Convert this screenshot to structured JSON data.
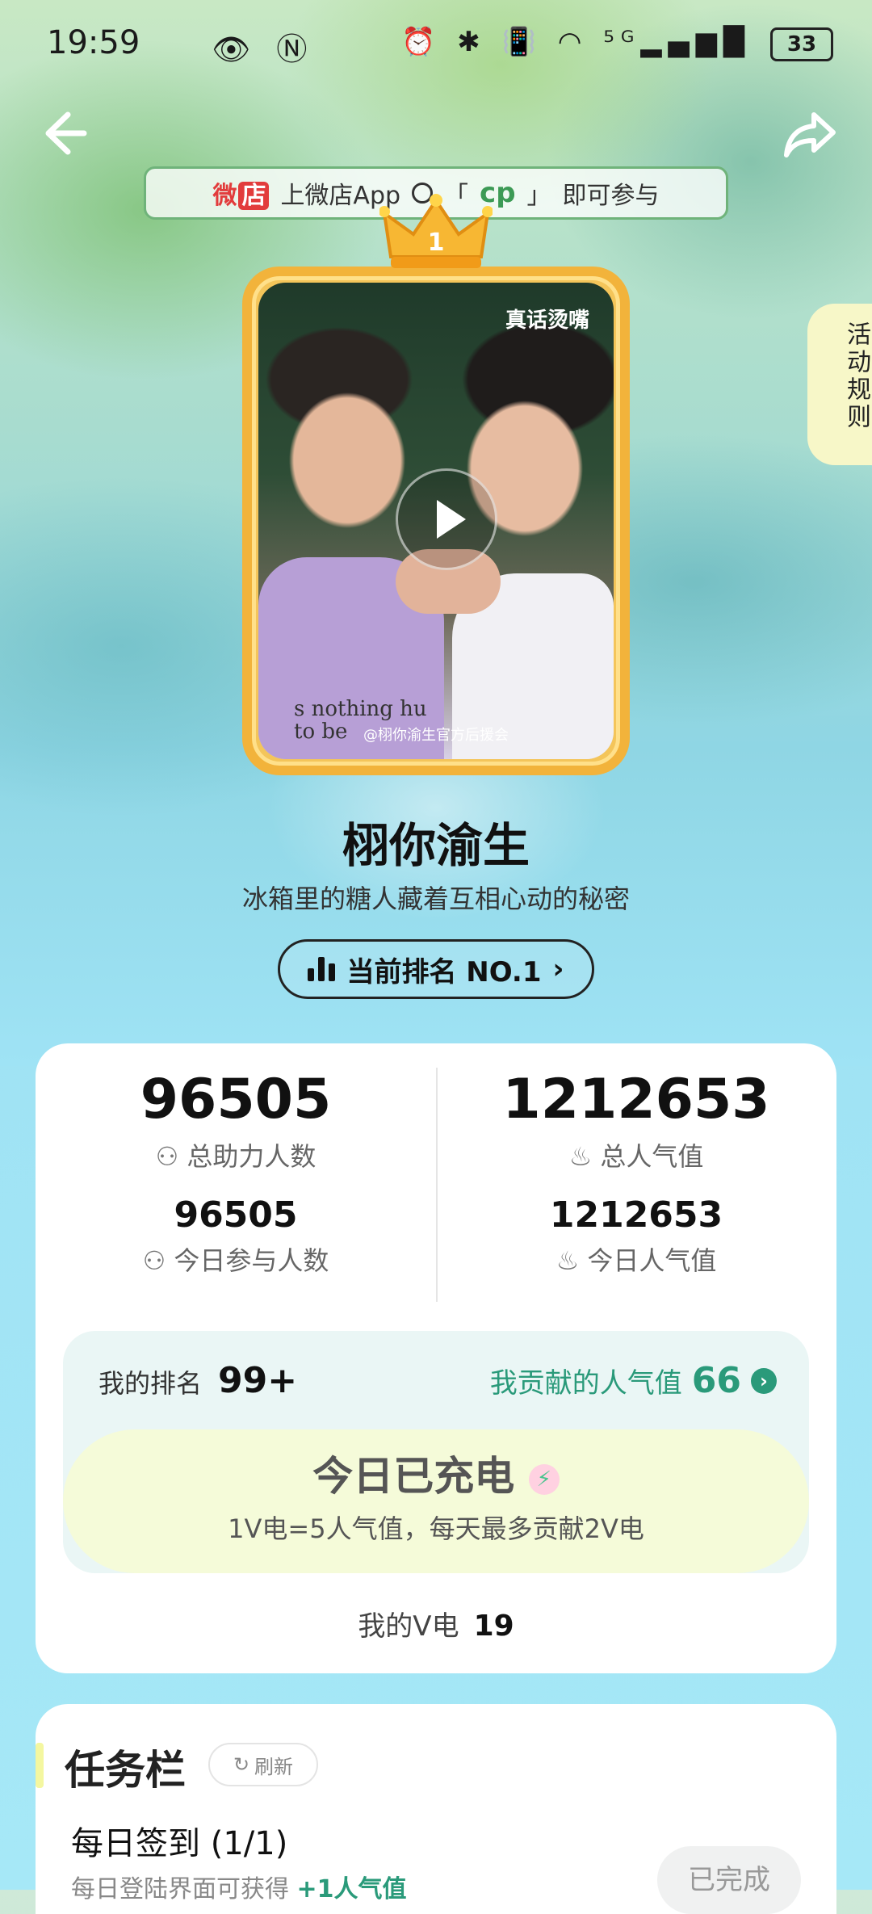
{
  "status_bar": {
    "time": "19:59",
    "left_icons": "👁 Ⓝ",
    "right_icons": "⏰ ✱ 📳 ◠ ⁵ᴳ▂▄▆█",
    "battery": "33"
  },
  "promo": {
    "weidian_prefix": "微",
    "weidian_badge": "店",
    "text_before": "上微店App",
    "bracket_open": "「",
    "keyword": "cp",
    "bracket_close": "」",
    "text_after": "即可参与"
  },
  "crown_number": "1",
  "video": {
    "caption": "真话烫嘴",
    "credit": "@栩你渝生官方后援会",
    "shirt_text": "s nothing hu\nto be"
  },
  "rules_tab": "活动规则",
  "title": "栩你渝生",
  "subtitle": "冰箱里的糖人藏着互相心动的秘密",
  "rank_pill": "当前排名 NO.1",
  "stats": {
    "total_helpers": "96505",
    "total_helpers_label": "总助力人数",
    "total_popularity": "1212653",
    "total_popularity_label": "总人气值",
    "today_participants": "96505",
    "today_participants_label": "今日参与人数",
    "today_popularity": "1212653",
    "today_popularity_label": "今日人气值"
  },
  "mine": {
    "rank_label": "我的排名",
    "rank_value": "99+",
    "contrib_label": "我贡献的人气值",
    "contrib_value": "66",
    "charge_title": "今日已充电",
    "charge_sub": "1V电=5人气值，每天最多贡献2V电",
    "v_label": "我的V电",
    "v_value": "19"
  },
  "tasks": {
    "title": "任务栏",
    "refresh": "刷新",
    "item_name": "每日签到 (1/1)",
    "item_desc_prefix": "每日登陆界面可获得",
    "item_desc_reward": "+1人气值",
    "item_status": "已完成"
  },
  "colors": {
    "accent_green": "#2a9a7a",
    "gold_frame": "#f2b33b",
    "charge_bg": "#f5fbd9"
  }
}
